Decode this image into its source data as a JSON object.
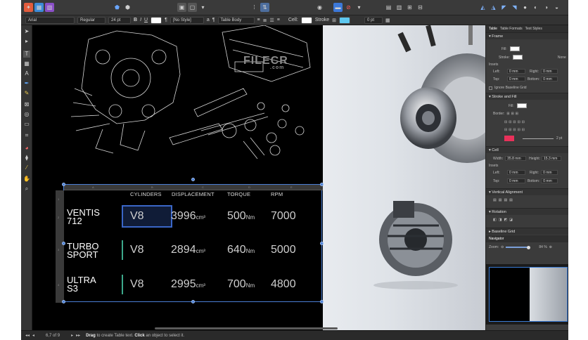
{
  "toolbar": {
    "buttons_left": [
      "persona-designer",
      "persona-pixel",
      "persona-export"
    ],
    "buttons_right_count": 8
  },
  "context": {
    "font": "Arial",
    "weight": "Regular",
    "size": "24 pt",
    "bold": "B",
    "italic": "I",
    "underline": "U",
    "style": "[No Style]",
    "table_style": "Table Body",
    "cell_label": "Cell:",
    "stroke_label": "Stroke",
    "stroke_size": "0 pt"
  },
  "watermark": {
    "name": "FILECR",
    "tld": ".com"
  },
  "table": {
    "col_letters": [
      "A",
      "B",
      "C",
      "D",
      "E"
    ],
    "row_numbers": [
      "1",
      "2",
      "3",
      "4"
    ],
    "headers": [
      "CYLINDERS",
      "DISPLACEMENT",
      "TORQUE",
      "RPM"
    ],
    "rows": [
      {
        "name": "VENTIS\n712",
        "cyl": "V8",
        "disp": "3996",
        "disp_unit": "cm³",
        "torque": "500",
        "torque_unit": "Nm",
        "rpm": "7000"
      },
      {
        "name": "TURBO\nSPORT",
        "cyl": "V8",
        "disp": "2894",
        "disp_unit": "cm³",
        "torque": "640",
        "torque_unit": "Nm",
        "rpm": "5000"
      },
      {
        "name": "ULTRA\nS3",
        "cyl": "V8",
        "disp": "2995",
        "disp_unit": "cm³",
        "torque": "700",
        "torque_unit": "Nm",
        "rpm": "4800"
      }
    ]
  },
  "panel": {
    "tabs": [
      "Table",
      "Table Formats",
      "Text Styles"
    ],
    "sections": {
      "frame": "Frame",
      "fill": "Fill:",
      "stroke": "Stroke:",
      "none": "None",
      "insets": "Insets",
      "left": "Left:",
      "right": "Right:",
      "top": "Top:",
      "bottom": "Bottom:",
      "zero_mm": "0 mm",
      "ignore_baseline": "Ignore Baseline Grid",
      "stroke_fill": "Stroke and Fill",
      "border": "Border:",
      "two_pt": "2 pt",
      "cell": "Cell",
      "width": "Width:",
      "width_val": "35.8 mm",
      "height": "Height:",
      "height_val": "15.3 mm",
      "vertical_alignment": "Vertical Alignment",
      "rotation": "Rotation",
      "baseline_grid": "Baseline Grid",
      "navigator": "Navigator",
      "zoom": "Zoom:",
      "zoom_val": "84 %"
    }
  },
  "status": {
    "page": "6,7 of 9",
    "hint_prefix": "Drag",
    "hint_mid": " to create Table text. ",
    "hint_click": "Click",
    "hint_suffix": " an object to select it."
  },
  "colors": {
    "accent": "#3f7fd6",
    "fill_swatch": "#e8315a",
    "selection": "#3a66c7"
  }
}
